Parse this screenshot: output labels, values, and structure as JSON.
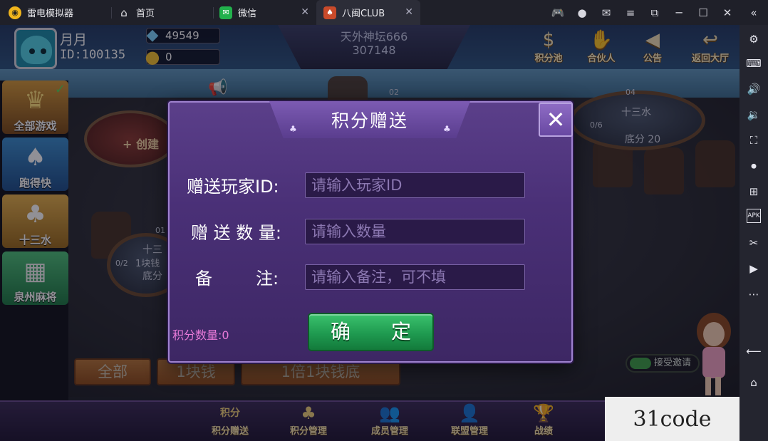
{
  "emulator": {
    "app_name": "雷电模拟器",
    "tabs": [
      {
        "label": "首页",
        "icon": "home-icon"
      },
      {
        "label": "微信",
        "icon": "wechat-icon"
      },
      {
        "label": "八闽CLUB",
        "icon": "game-app-icon"
      }
    ],
    "window_buttons": [
      "gamepad-icon",
      "user-icon",
      "mail-icon",
      "menu-icon",
      "popout-icon",
      "minimize-icon",
      "maximize-icon",
      "close-icon",
      "collapse-icon"
    ],
    "sidebar_icons": [
      "settings-icon",
      "keyboard-icon",
      "volume-up-icon",
      "volume-down-icon",
      "screenshot-icon",
      "record-icon",
      "add-window-icon",
      "apk-icon",
      "scissors-icon",
      "video-icon",
      "more-icon",
      "back-icon",
      "home-icon"
    ]
  },
  "player": {
    "name": "月月",
    "id_text": "ID:100135",
    "diamonds": "49549",
    "gold": "0"
  },
  "club": {
    "name": "天外神坛666",
    "number": "307148"
  },
  "top_actions": [
    "积分池",
    "合伙人",
    "公告",
    "返回大厅"
  ],
  "left_categories": [
    "全部游戏",
    "跑得快",
    "十三水",
    "泉州麻将"
  ],
  "tables": {
    "table_04": {
      "no": "04",
      "game": "十三水",
      "players": "0/6",
      "base": "底分 20"
    },
    "table_01": {
      "no": "01",
      "game": "十三",
      "players": "0/2",
      "bet": "1块钱",
      "base": "底分"
    },
    "table_02": {
      "no": "02"
    },
    "create_label": "+ 创建"
  },
  "filters": [
    "全部",
    "1块钱",
    "1倍1块钱底"
  ],
  "invite_label": "接受邀请",
  "bottom_nav": [
    "积分赠送",
    "积分管理",
    "成员管理",
    "联盟管理",
    "战绩"
  ],
  "bottom_nav_top": "积分",
  "dialog": {
    "title": "积分赠送",
    "fields": [
      {
        "label": "赠送玩家ID:",
        "placeholder": "请输入玩家ID"
      },
      {
        "label": "赠 送 数 量:",
        "placeholder": "请输入数量"
      },
      {
        "label": "备        注:",
        "placeholder": "请输入备注，可不填"
      }
    ],
    "score_label": "积分数量:0",
    "confirm_label": "确 定"
  },
  "watermark": "31code",
  "colors": {
    "dialog_bg": "#4a3077",
    "confirm_green": "#1f9a50",
    "score_pink": "#e87ad8"
  }
}
